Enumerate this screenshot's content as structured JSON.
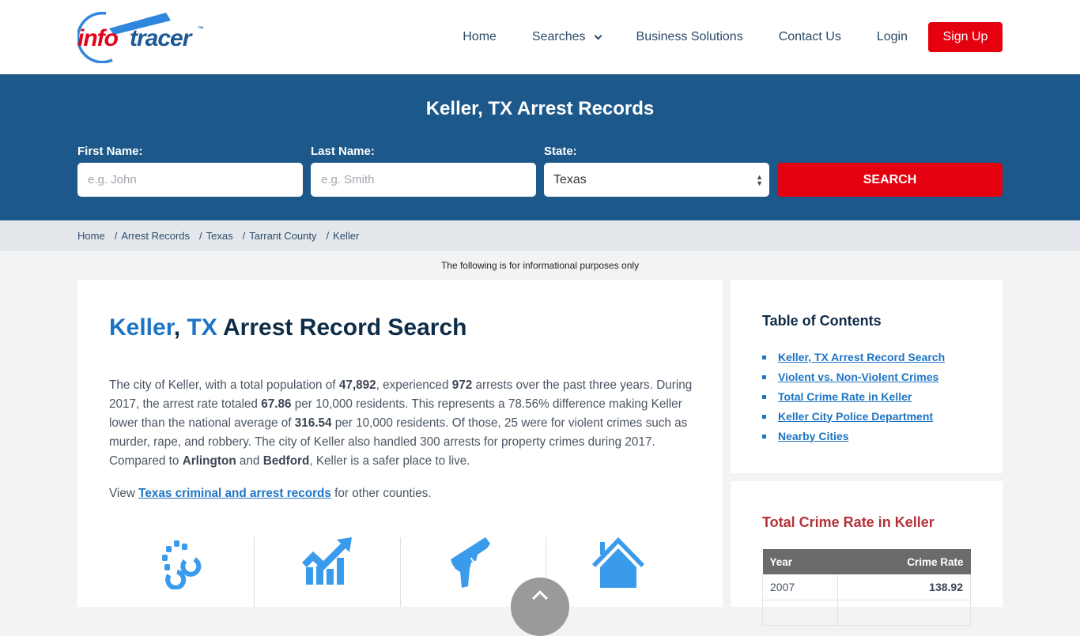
{
  "header": {
    "logo": {
      "part1": "info",
      "part2": "tracer",
      "tm": "™"
    },
    "nav": {
      "home": "Home",
      "searches": "Searches",
      "business": "Business Solutions",
      "contact": "Contact Us",
      "login": "Login",
      "signup": "Sign Up"
    }
  },
  "hero": {
    "title": "Keller, TX Arrest Records",
    "first_name_label": "First Name:",
    "first_name_placeholder": "e.g. John",
    "last_name_label": "Last Name:",
    "last_name_placeholder": "e.g. Smith",
    "state_label": "State:",
    "state_value": "Texas",
    "search_button": "SEARCH"
  },
  "breadcrumb": [
    "Home",
    "Arrest Records",
    "Texas",
    "Tarrant County",
    "Keller"
  ],
  "info_note": "The following is for informational purposes only",
  "main": {
    "heading_city": "Keller",
    "heading_comma": ",",
    "heading_state": "TX",
    "heading_rest": "Arrest Record Search",
    "para": {
      "t1": "The city of Keller, with a total population of ",
      "population": "47,892",
      "t2": ", experienced ",
      "arrests": "972",
      "t3": " arrests over the past three years. During 2017, the arrest rate totaled ",
      "rate": "67.86",
      "t4": " per 10,000 residents. This represents a 78.56% difference making Keller lower than the national average of ",
      "national": "316.54",
      "t5": " per 10,000 residents. Of those, 25 were for violent crimes such as murder, rape, and robbery. The city of Keller also handled 300 arrests for property crimes during 2017. Compared to ",
      "city1": "Arlington",
      "t6": " and ",
      "city2": "Bedford",
      "t7": ", Keller is a safer place to live."
    },
    "view": {
      "prefix": "View ",
      "link": "Texas criminal and arrest records",
      "suffix": " for other counties."
    },
    "icons": [
      "handcuffs-icon",
      "chart-growth-icon",
      "gun-icon",
      "house-icon"
    ],
    "icon_color": "#3a9bec"
  },
  "toc": {
    "title": "Table of Contents",
    "items": [
      "Keller, TX Arrest Record Search",
      "Violent vs. Non-Violent Crimes",
      "Total Crime Rate in Keller",
      "Keller City Police Department",
      "Nearby Cities"
    ]
  },
  "crime_rate": {
    "title": "Total Crime Rate in Keller",
    "columns": [
      "Year",
      "Crime Rate"
    ],
    "rows": [
      {
        "year": "2007",
        "rate": "138.92"
      }
    ]
  },
  "colors": {
    "brand_blue": "#1c588a",
    "accent_red": "#e50010",
    "link_blue": "#1e74c4",
    "rate_title_red": "#b5323a"
  }
}
